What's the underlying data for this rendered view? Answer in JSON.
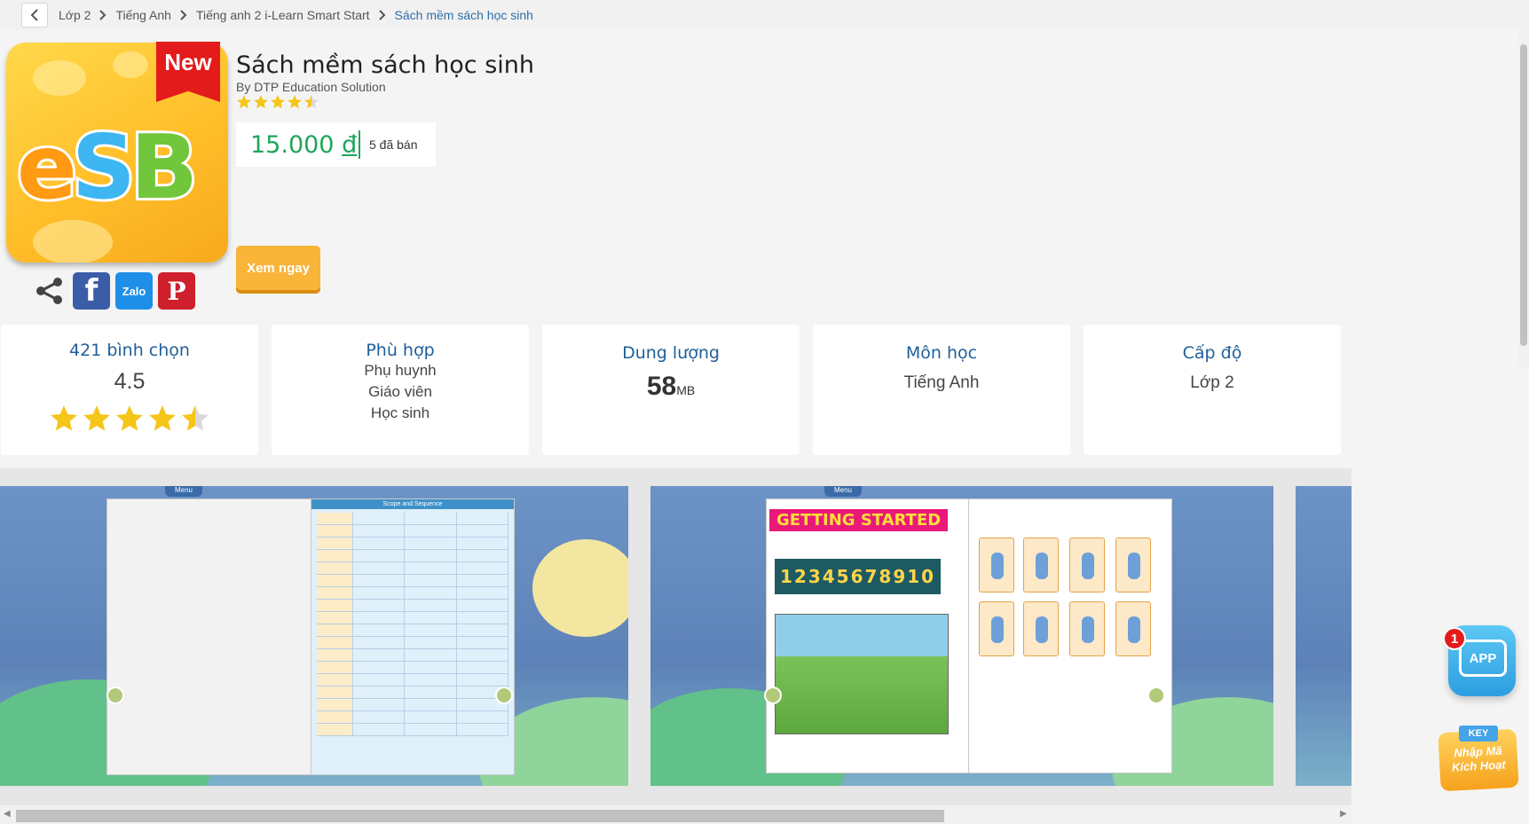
{
  "breadcrumb": {
    "items": [
      "Lớp 2",
      "Tiếng Anh",
      "Tiếng anh 2 i-Learn Smart Start",
      "Sách mềm sách học sinh"
    ]
  },
  "product": {
    "badge": "New",
    "cover_logo": "eSB",
    "title": "Sách mềm sách học sinh",
    "author": "By DTP Education Solution",
    "rating": 4.5,
    "price": "15.000",
    "currency": "đ",
    "sold": "5 đã bán",
    "view_button": "Xem ngay"
  },
  "share": {
    "icons": [
      "share-icon",
      "facebook-icon",
      "zalo-icon",
      "pinterest-icon"
    ],
    "zalo_label": "Zalo"
  },
  "cards": {
    "votes": {
      "title": "421 bình chọn",
      "value": "4.5",
      "rating": 4.5
    },
    "suitable": {
      "title": "Phù hợp",
      "lines": [
        "Phụ huynh",
        "Giáo viên",
        "Học sinh"
      ]
    },
    "size": {
      "title": "Dung lượng",
      "value": "58",
      "unit": "MB"
    },
    "subject": {
      "title": "Môn học",
      "value": "Tiếng Anh"
    },
    "level": {
      "title": "Cấp độ",
      "value": "Lớp 2"
    }
  },
  "gallery": {
    "menu_label": "Menu",
    "scope_title": "Scope and Sequence",
    "getting_started": "GETTING STARTED",
    "numbers": "12345678910"
  },
  "floating": {
    "app_label": "APP",
    "app_badge": "1",
    "key_tag": "KEY",
    "key_label_1": "Nhập Mã",
    "key_label_2": "Kích Hoạt"
  },
  "colors": {
    "price": "#1ea65a",
    "card_title": "#1f5f99",
    "view_button": "#f8b53a",
    "breadcrumb_active": "#2e6ea8",
    "star": "#f5c518"
  }
}
